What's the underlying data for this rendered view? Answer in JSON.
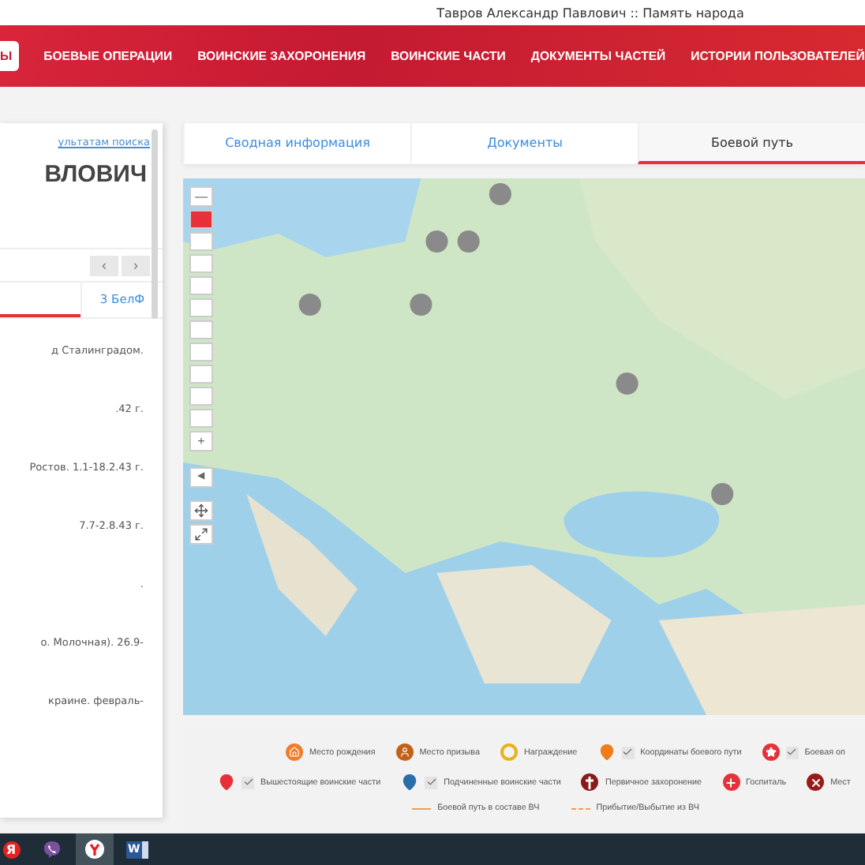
{
  "window": {
    "title": "Тавров Александр Павлович :: Память народа"
  },
  "nav": [
    {
      "label": "Ы",
      "selected": true
    },
    {
      "label": "БОЕВЫЕ ОПЕРАЦИИ",
      "selected": false
    },
    {
      "label": "ВОИНСКИЕ ЗАХОРОНЕНИЯ",
      "selected": false
    },
    {
      "label": "ВОИНСКИЕ ЧАСТИ",
      "selected": false
    },
    {
      "label": "ДОКУМЕНТЫ ЧАСТЕЙ",
      "selected": false
    },
    {
      "label": "ИСТОРИИ ПОЛЬЗОВАТЕЛЕЙ",
      "selected": false
    }
  ],
  "sidebar": {
    "back_link": "ультатам поиска",
    "name": "ВЛОВИЧ",
    "prev": "‹",
    "next": "›",
    "tabs": [
      {
        "selected": true
      },
      {
        "label": "3 БелФ",
        "selected": false
      }
    ],
    "entries": [
      "д Сталинградом.",
      ".42 г.",
      "Ростов. 1.1-18.2.43 г.",
      "7.7-2.8.43 г.",
      ".",
      "о. Молочная). 26.9-",
      "краине. февраль-"
    ]
  },
  "tabs": [
    {
      "label": "Сводная информация",
      "selected": false
    },
    {
      "label": "Документы",
      "selected": false
    },
    {
      "label": "Боевой путь",
      "selected": true
    }
  ],
  "map": {
    "zoom_out": "—",
    "zoom_in": "+",
    "collapse": "◀",
    "zoom_steps": [
      {
        "selected": true
      },
      {
        "selected": false
      },
      {
        "selected": false
      },
      {
        "selected": false
      },
      {
        "selected": false
      },
      {
        "selected": false
      },
      {
        "selected": false
      },
      {
        "selected": false
      },
      {
        "selected": false
      },
      {
        "selected": false
      }
    ]
  },
  "legend": {
    "top_row": [
      {
        "kind": "house",
        "color": "#f07d2a",
        "label": "Место рождения"
      },
      {
        "kind": "person",
        "color": "#c0621a",
        "label": "Место призыва"
      },
      {
        "kind": "award",
        "color": "#e8b21a",
        "label": "Награждение"
      },
      {
        "kind": "pin",
        "color": "#f07d1a",
        "label": "Координаты боевого пути",
        "checked": true
      },
      {
        "kind": "star",
        "color": "#e8303a",
        "label": "Боевая оп",
        "checked": true
      }
    ],
    "bottom_row": [
      {
        "kind": "pin",
        "color": "#e8303a",
        "label": "Вышестоящие воинские части",
        "checked": true
      },
      {
        "kind": "pin",
        "color": "#2a6fa8",
        "label": "Подчиненные воинские части",
        "checked": true
      },
      {
        "kind": "cross",
        "color": "#8a1a1a",
        "label": "Первичное захоронение"
      },
      {
        "kind": "plus",
        "color": "#e8303a",
        "label": "Госпиталь"
      },
      {
        "kind": "x",
        "color": "#9a1a1a",
        "label": "Мест"
      }
    ],
    "lines": [
      {
        "kind": "solid",
        "label": "Боевой путь в составе ВЧ"
      },
      {
        "kind": "dashed",
        "label": "Прибытие/Выбытие из ВЧ"
      }
    ]
  },
  "taskbar": [
    {
      "kind": "yandex",
      "label": "Я",
      "selected": false
    },
    {
      "kind": "viber",
      "selected": false
    },
    {
      "kind": "browser",
      "selected": true
    },
    {
      "kind": "word",
      "label": "W",
      "selected": false
    }
  ]
}
